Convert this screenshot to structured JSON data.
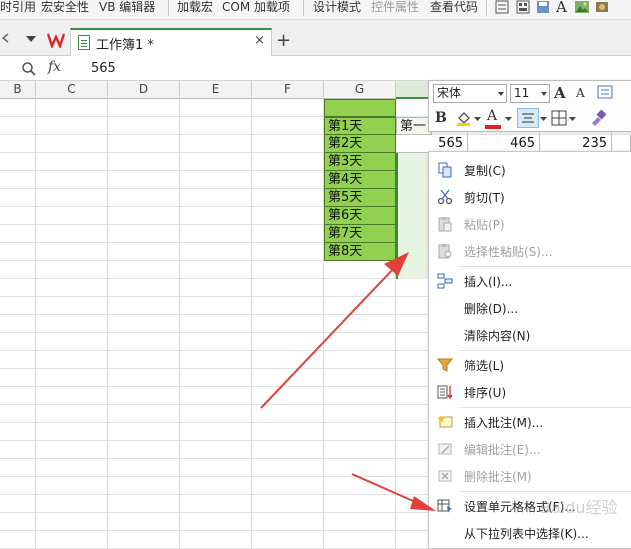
{
  "ribbon": {
    "items": [
      "时引用",
      "宏安全性",
      "VB 编辑器",
      "加载宏",
      "COM 加载项",
      "设计模式",
      "控件属性",
      "查看代码"
    ]
  },
  "tab": {
    "title": "工作簿1 *",
    "close": "×",
    "new_tab": "+"
  },
  "formula": {
    "fx": "fx",
    "value": "565"
  },
  "columns": [
    "B",
    "C",
    "D",
    "E",
    "F",
    "G"
  ],
  "partial_header": "第一",
  "rows": [
    "第1天",
    "第2天",
    "第3天",
    "第4天",
    "第5天",
    "第6天",
    "第7天",
    "第8天"
  ],
  "first_row_values": [
    "565",
    "465",
    "235"
  ],
  "minibar": {
    "font": "宋体",
    "size": "11",
    "bold": "B",
    "grow": "A",
    "shrink": "A",
    "fontcolor": "A",
    "font_color_hex": "#e02020",
    "fill_color_hex": "#f5d300"
  },
  "menu": [
    {
      "label": "复制(C)",
      "icon": "copy-icon",
      "disabled": false
    },
    {
      "label": "剪切(T)",
      "icon": "scissors-icon",
      "disabled": false
    },
    {
      "label": "粘贴(P)",
      "icon": "paste-icon",
      "disabled": true
    },
    {
      "label": "选择性粘贴(S)...",
      "icon": "paste-special-icon",
      "disabled": true
    },
    {
      "label": "插入(I)...",
      "icon": "insert-icon",
      "disabled": false
    },
    {
      "label": "删除(D)...",
      "icon": "",
      "disabled": false
    },
    {
      "label": "清除内容(N)",
      "icon": "",
      "disabled": false
    },
    {
      "label": "筛选(L)",
      "icon": "filter-icon",
      "disabled": false
    },
    {
      "label": "排序(U)",
      "icon": "sort-icon",
      "disabled": false
    },
    {
      "label": "插入批注(M)...",
      "icon": "comment-add-icon",
      "disabled": false
    },
    {
      "label": "编辑批注(E)...",
      "icon": "comment-edit-icon",
      "disabled": true
    },
    {
      "label": "删除批注(M)",
      "icon": "comment-delete-icon",
      "disabled": true
    },
    {
      "label": "设置单元格格式(F)...",
      "icon": "format-cells-icon",
      "disabled": false
    },
    {
      "label": "从下拉列表中选择(K)...",
      "icon": "",
      "disabled": false
    }
  ],
  "watermark": "Baidu经验",
  "colors": {
    "accent": "#3c8e40",
    "label_fill": "#92d050",
    "arrow": "#e0413a"
  }
}
